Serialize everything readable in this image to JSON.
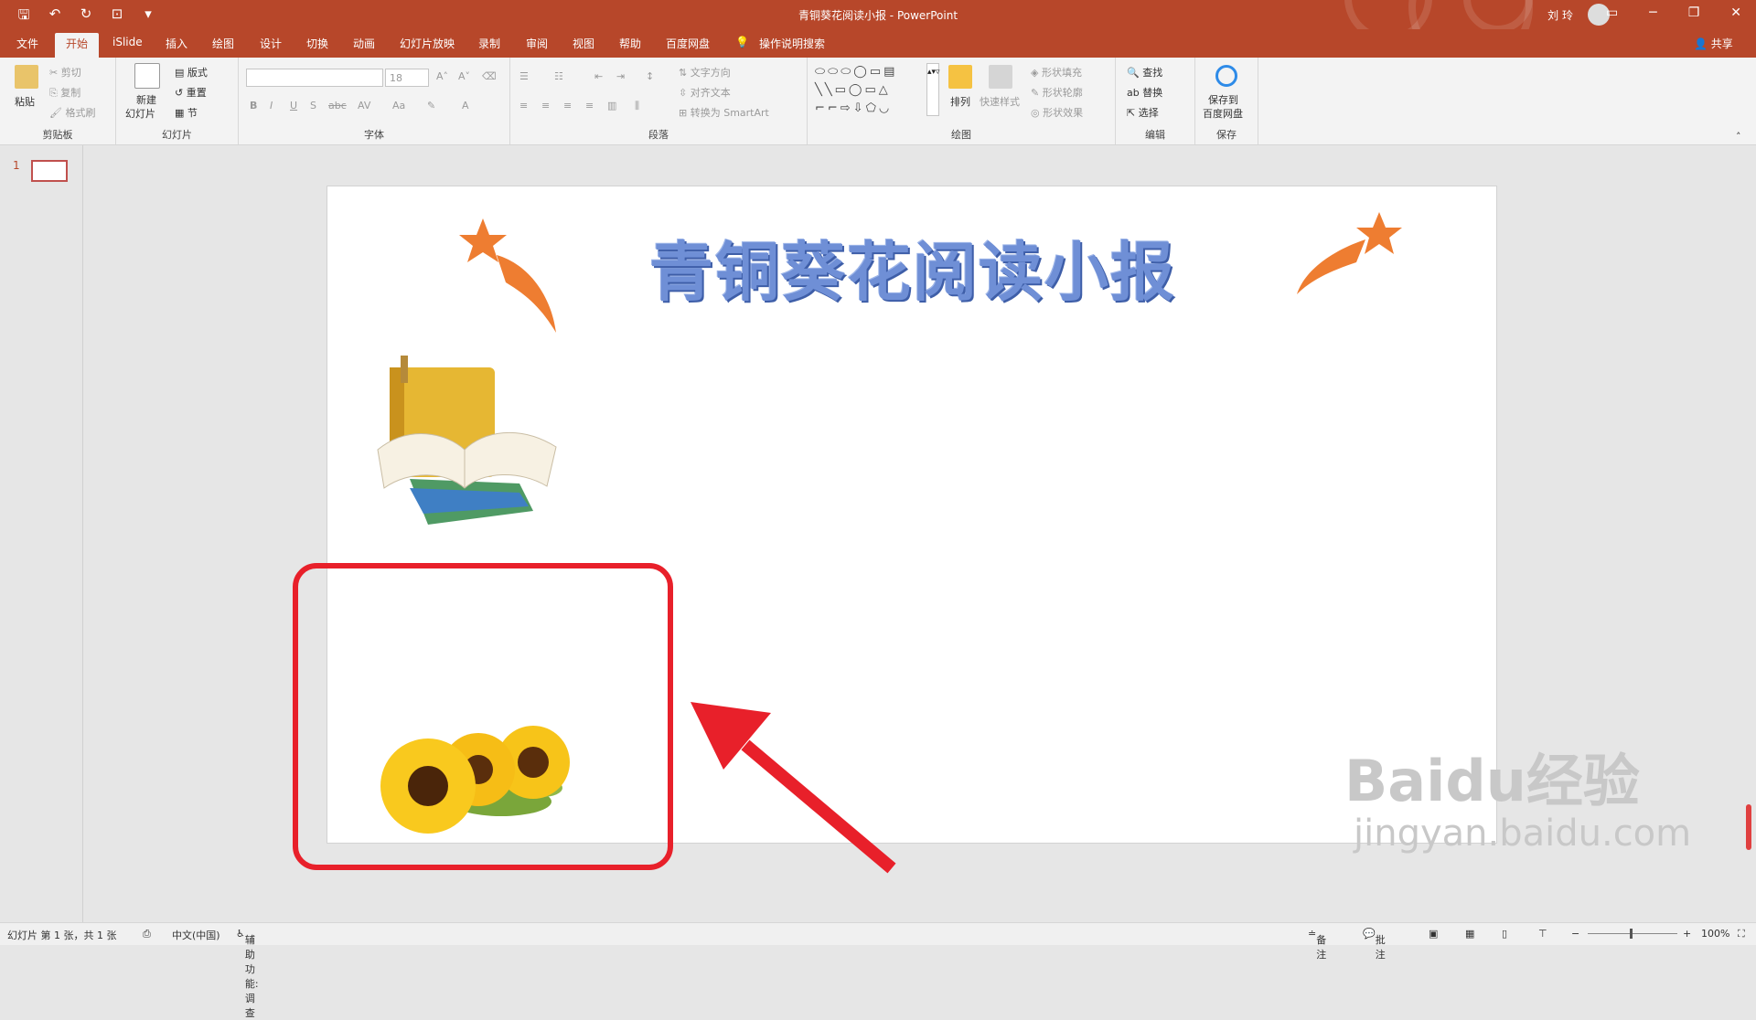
{
  "window": {
    "doc_title": "青铜葵花阅读小报",
    "app_separator": " - ",
    "app_name": "PowerPoint",
    "user_name": "刘 玲",
    "share_label": "共享"
  },
  "tabs": [
    "文件",
    "开始",
    "iSlide",
    "插入",
    "绘图",
    "设计",
    "切换",
    "动画",
    "幻灯片放映",
    "录制",
    "审阅",
    "视图",
    "帮助",
    "百度网盘"
  ],
  "active_tab": "开始",
  "tell_me": "操作说明搜索",
  "ribbon": {
    "clipboard": {
      "paste": "粘贴",
      "cut": "剪切",
      "copy": "复制",
      "format_painter": "格式刷",
      "label": "剪贴板"
    },
    "slides": {
      "new_slide_1": "新建",
      "new_slide_2": "幻灯片",
      "layout": "版式",
      "reset": "重置",
      "section": "节",
      "label": "幻灯片"
    },
    "font": {
      "font_size": "18",
      "bold": "B",
      "italic": "I",
      "underline": "U",
      "shadow": "S",
      "strike": "abc",
      "label": "字体"
    },
    "paragraph": {
      "text_direction": "文字方向",
      "align_text": "对齐文本",
      "smartart": "转换为 SmartArt",
      "label": "段落"
    },
    "drawing": {
      "arrange": "排列",
      "quick_styles": "快速样式",
      "shape_fill": "形状填充",
      "shape_outline": "形状轮廓",
      "shape_effects": "形状效果",
      "label": "绘图"
    },
    "editing": {
      "find": "查找",
      "replace": "替换",
      "select": "选择",
      "label": "编辑"
    },
    "save": {
      "save_to_1": "保存到",
      "save_to_2": "百度网盘",
      "label": "保存"
    }
  },
  "thumbnails": [
    {
      "number": "1"
    }
  ],
  "slide": {
    "title": "青铜葵花阅读小报"
  },
  "status": {
    "slide_info": "幻灯片 第 1 张，共 1 张",
    "language": "中文(中国)",
    "accessibility": "辅助功能: 调查",
    "notes": "备注",
    "comments": "批注",
    "zoom": "100%"
  },
  "watermark": {
    "brand": "Baidu经验",
    "url": "jingyan.baidu.com"
  },
  "colors": {
    "accent": "#b7472a",
    "highlight_box": "#e8202a",
    "title_blue": "#6f8fd6",
    "star_orange": "#ee7d31"
  }
}
